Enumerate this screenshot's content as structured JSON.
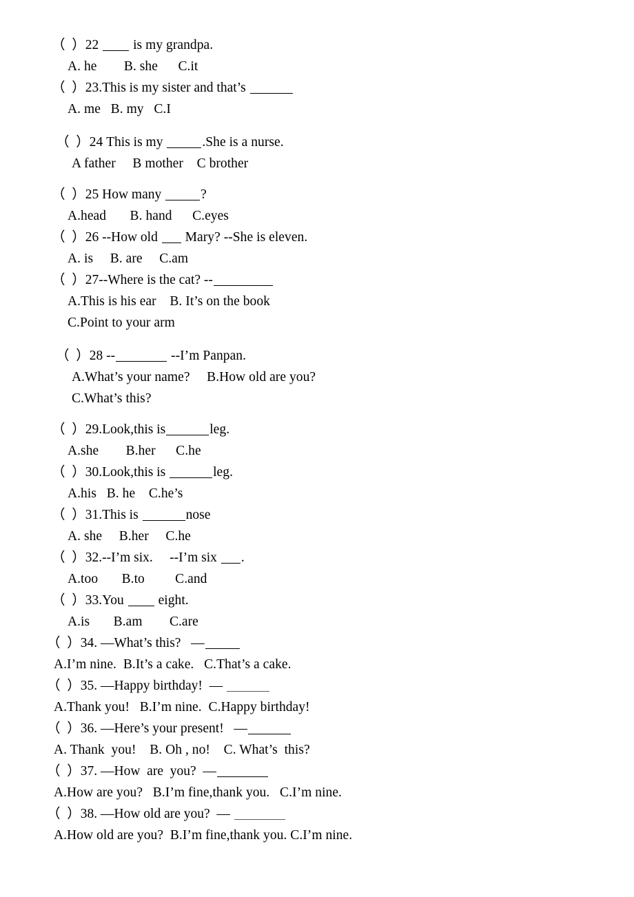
{
  "document": {
    "type": "english-multiple-choice-worksheet",
    "page_background": "#ffffff",
    "text_color": "#000000",
    "marker_open": "（",
    "marker_close": "）",
    "items": [
      {
        "number": "22",
        "stem_prefix": "（  ）22 ",
        "stem_before": "",
        "blank": "b-sm",
        "stem_after": " is my grandpa.",
        "options": "A. he        B. she      C.it",
        "indent": "normal"
      },
      {
        "number": "23",
        "stem_prefix": "（  ）23.This is my sister and that’s ",
        "stem_before": "",
        "blank": "b-lg",
        "stem_after": "",
        "options": "A. me   B. my   C.I",
        "indent": "normal"
      },
      {
        "number": "24",
        "stem_prefix": "（  ）24 This is my ",
        "stem_before": "",
        "blank": "b-md",
        "stem_after": ".She is a nurse.",
        "options": "A father     B mother    C brother",
        "indent": "deep"
      },
      {
        "number": "25",
        "stem_prefix": "（  ）25 How many ",
        "stem_before": "",
        "blank": "b-md",
        "stem_after": "?",
        "options": "A.head       B. hand      C.eyes",
        "indent": "normal"
      },
      {
        "number": "26",
        "stem_prefix": "（  ）26 --How old ",
        "stem_before": "",
        "blank": "b-xs",
        "stem_after": " Mary? --She is eleven.",
        "options": "A. is     B. are     C.am",
        "indent": "normal"
      },
      {
        "number": "27",
        "stem_prefix": "（  ）27--Where is the cat? --",
        "stem_before": "",
        "blank": "b-xxl",
        "stem_after": "",
        "options": "A.This is his ear    B. It’s on the book",
        "options_line2": "C.Point to your arm",
        "indent": "normal"
      },
      {
        "number": "28",
        "stem_prefix": "（  ）28 --",
        "stem_before": "",
        "blank": "b-xl",
        "stem_after": " --I’m Panpan.",
        "options": "A.What’s your name?     B.How old are you?",
        "options_line2": "C.What’s this?",
        "indent": "deep"
      },
      {
        "number": "29",
        "stem_prefix": "（  ）29.Look,this is",
        "stem_before": "",
        "blank": "b-lg",
        "stem_after": "leg.",
        "options": "A.she        B.her      C.he",
        "indent": "normal"
      },
      {
        "number": "30",
        "stem_prefix": "（  ）30.Look,this is ",
        "stem_before": "",
        "blank": "b-lg",
        "stem_after": "leg.",
        "options": "A.his   B. he    C.he’s",
        "indent": "normal"
      },
      {
        "number": "31",
        "stem_prefix": "（  ）31.This is ",
        "stem_before": "",
        "blank": "b-lg",
        "stem_after": "nose",
        "options": "A. she     B.her     C.he",
        "indent": "normal"
      },
      {
        "number": "32",
        "stem_prefix": "（  ）32.--I’m six.     --I’m six ",
        "stem_before": "",
        "blank": "b-xs",
        "stem_after": ".",
        "options": "A.too       B.to         C.and",
        "indent": "normal"
      },
      {
        "number": "33",
        "stem_prefix": "（  ）33.You ",
        "stem_before": "",
        "blank": "b-sm",
        "stem_after": " eight.",
        "options": "A.is       B.am        C.are",
        "indent": "normal"
      },
      {
        "number": "34",
        "stem_prefix": "（  ）34. —What’s this?   —",
        "stem_before": "",
        "blank": "b-md",
        "stem_after": "",
        "options": "A.I’m nine.  B.It’s a cake.   C.That’s a cake.",
        "indent": "out"
      },
      {
        "number": "35",
        "stem_prefix": "（  ）35. —Happy birthday!  — ",
        "stem_before": "",
        "blank": "b-lg faint",
        "stem_after": "",
        "options": "A.Thank you!   B.I’m nine.  C.Happy birthday!",
        "indent": "out"
      },
      {
        "number": "36",
        "stem_prefix": "（  ）36. —Here’s your present!   —",
        "stem_before": "",
        "blank": "b-lg",
        "stem_after": "",
        "options": "A. Thank  you!    B. Oh , no!    C. What’s  this?",
        "indent": "out"
      },
      {
        "number": "37",
        "stem_prefix": "（  ）37. —How  are  you?  —",
        "stem_before": "",
        "blank": "b-xl",
        "stem_after": "",
        "options": "A.How are you?   B.I’m fine,thank you.   C.I’m nine.",
        "indent": "out"
      },
      {
        "number": "38",
        "stem_prefix": "（  ）38. —How old are you?  — ",
        "stem_before": "",
        "blank": "b-xl faint",
        "stem_after": "",
        "options": "A.How old are you?  B.I’m fine,thank you. C.I’m nine.",
        "indent": "out"
      }
    ]
  }
}
